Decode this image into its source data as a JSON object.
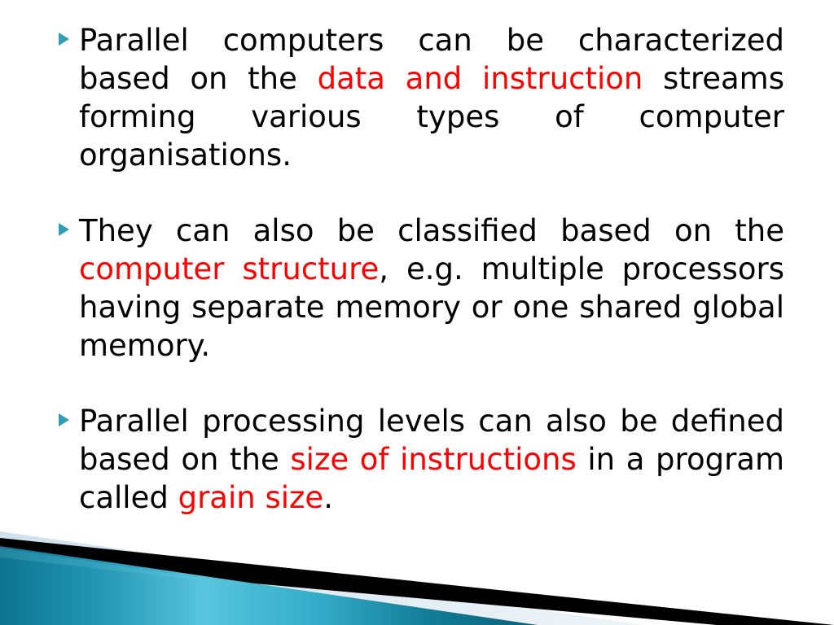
{
  "slide": {
    "background_color": "#FFFFFF",
    "body_text_color": "#000000",
    "highlight_color": "#FF0000",
    "bullet_color": "#2E9DB5"
  },
  "bullets": [
    {
      "marker": "triangle-bullet-icon",
      "segments": [
        {
          "text": "Parallel computers can be characterized based on the ",
          "style": "normal"
        },
        {
          "text": "data and instruction",
          "style": "highlight"
        },
        {
          "text": " streams forming various types of computer organisations.",
          "style": "normal"
        }
      ],
      "plain": "Parallel computers can be characterized based on the data and instruction streams forming various types of computer organisations."
    },
    {
      "marker": "triangle-bullet-icon",
      "segments": [
        {
          "text": "They can also be classified based on the ",
          "style": "normal"
        },
        {
          "text": "computer structure",
          "style": "highlight"
        },
        {
          "text": ", e.g. multiple processors having separate memory or one shared global memory.",
          "style": "normal"
        }
      ],
      "plain": "They can also be classified based on the computer structure, e.g. multiple processors having separate memory or one shared global memory."
    },
    {
      "marker": "triangle-bullet-icon",
      "segments": [
        {
          "text": "Parallel processing levels can also be defined based on the ",
          "style": "normal"
        },
        {
          "text": "size of instructions",
          "style": "highlight"
        },
        {
          "text": " in a program called ",
          "style": "normal"
        },
        {
          "text": "grain size",
          "style": "highlight"
        },
        {
          "text": ".",
          "style": "normal"
        }
      ],
      "plain": "Parallel processing levels can also be defined based on the size of instructions in a program called grain size."
    }
  ],
  "decoration": {
    "name": "corner-ribbon-graphic",
    "bands": [
      {
        "name": "light-blue-band",
        "color": "#DCE9F1"
      },
      {
        "name": "black-stripe",
        "color": "#000000"
      },
      {
        "name": "teal-wedge",
        "color_start": "#0E7B96",
        "color_mid": "#5CC6DF",
        "color_end": "#0B6E87"
      }
    ]
  }
}
